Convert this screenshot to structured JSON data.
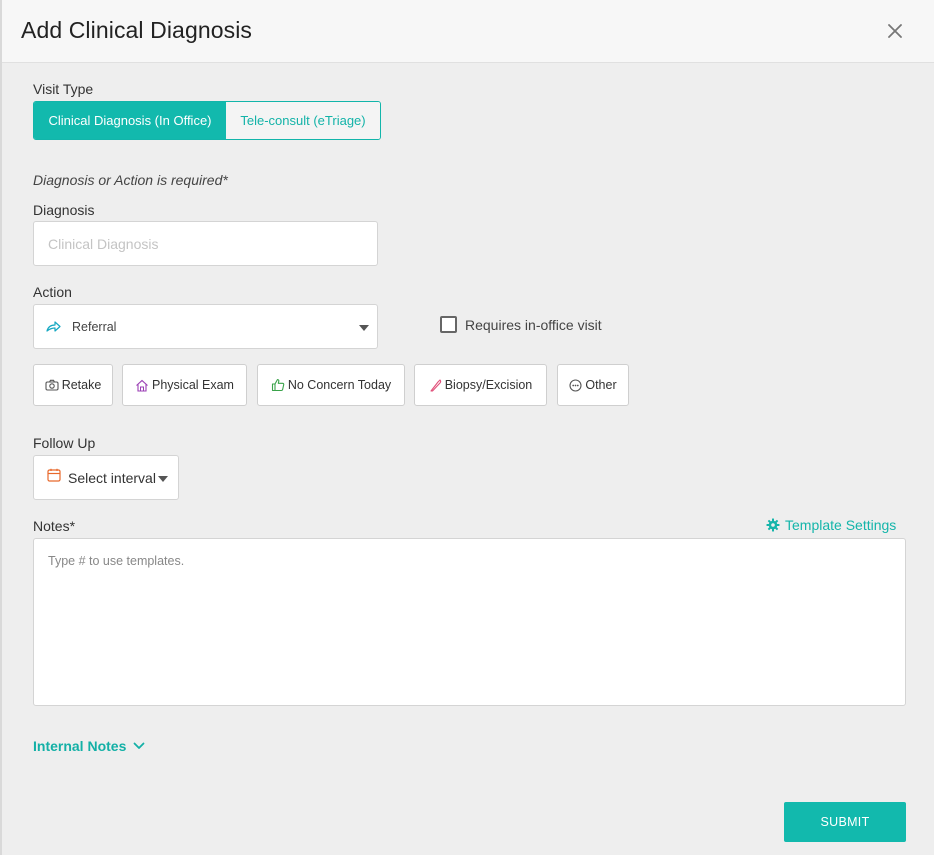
{
  "modal": {
    "title": "Add Clinical Diagnosis",
    "close_icon": "close-icon"
  },
  "visit_type": {
    "label": "Visit Type",
    "options": [
      {
        "label": "Clinical Diagnosis (In Office)",
        "selected": true
      },
      {
        "label": "Tele-consult (eTriage)",
        "selected": false
      }
    ]
  },
  "requirement_note": "Diagnosis or Action is required*",
  "diagnosis": {
    "label": "Diagnosis",
    "placeholder": "Clinical Diagnosis",
    "value": ""
  },
  "action": {
    "label": "Action",
    "selected_value": "Referral",
    "selected_icon": "share-arrow-icon",
    "checkbox_label": "Requires in-office visit",
    "checkbox_checked": false,
    "quick_actions": [
      {
        "label": "Retake",
        "icon": "camera-icon",
        "icon_color": "#555555"
      },
      {
        "label": "Physical Exam",
        "icon": "house-icon",
        "icon_color": "#9b3fb5"
      },
      {
        "label": "No Concern Today",
        "icon": "thumbs-up-icon",
        "icon_color": "#3aa34a"
      },
      {
        "label": "Biopsy/Excision",
        "icon": "scalpel-icon",
        "icon_color": "#e0507a"
      },
      {
        "label": "Other",
        "icon": "dots-circle-icon",
        "icon_color": "#555555"
      }
    ]
  },
  "follow_up": {
    "label": "Follow Up",
    "placeholder": "Select interval",
    "icon": "calendar-icon",
    "icon_color": "#e8692c"
  },
  "notes": {
    "label": "Notes*",
    "placeholder": "Type # to use templates.",
    "value": "",
    "template_link": "Template Settings",
    "template_icon": "gear-icon"
  },
  "internal_notes": {
    "label": "Internal Notes",
    "icon": "chevron-down-icon"
  },
  "submit": {
    "label": "SUBMIT"
  },
  "colors": {
    "accent": "#12b9ad",
    "background": "#eeeeee",
    "header_background": "#f7f7f7"
  }
}
